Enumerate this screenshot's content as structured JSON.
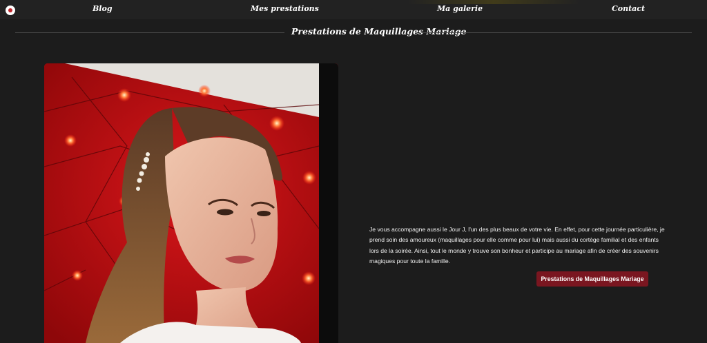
{
  "nav": {
    "logo_icon": "brand-logo-icon",
    "items": [
      {
        "label": "Blog"
      },
      {
        "label": "Mes prestations"
      },
      {
        "label": "Ma galerie"
      },
      {
        "label": "Contact"
      }
    ]
  },
  "section": {
    "title": "Prestations de Maquillages Mariage"
  },
  "content": {
    "photo_alt": "bride-portrait",
    "description": "Je vous accompagne aussi le Jour J, l'un des plus beaux de votre vie. En effet, pour cette journée particulière, je prend soin des amoureux (maquillages pour elle comme pour lui) mais aussi du cortège familial et des enfants lors de la soirée. Ainsi, tout le monde y trouve son bonheur et participe au mariage afin de créer des souvenirs magiques pour toute la famille.",
    "cta_label": "Prestations de Maquillages Mariage"
  },
  "colors": {
    "background": "#1c1c1c",
    "nav_background": "#222222",
    "accent": "#7a1620"
  }
}
